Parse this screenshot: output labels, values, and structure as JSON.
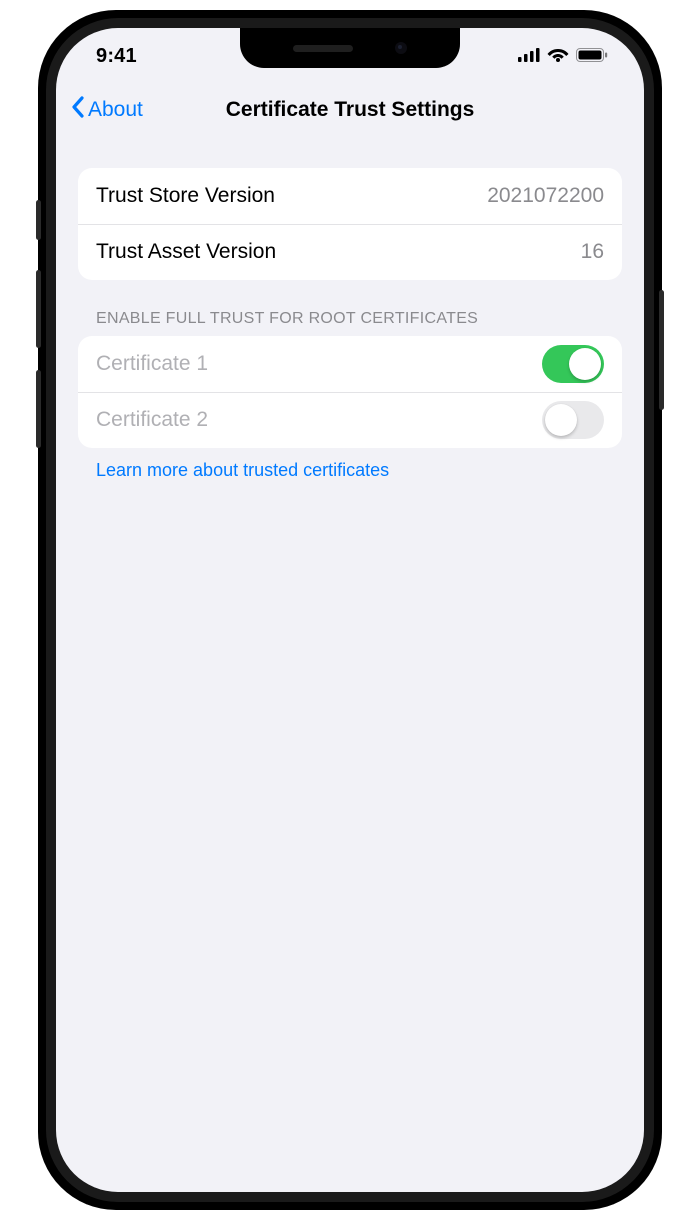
{
  "statusBar": {
    "time": "9:41"
  },
  "nav": {
    "back": "About",
    "title": "Certificate Trust Settings"
  },
  "versions": {
    "rows": [
      {
        "label": "Trust Store Version",
        "value": "2021072200"
      },
      {
        "label": "Trust Asset Version",
        "value": "16"
      }
    ]
  },
  "trustSection": {
    "header": "ENABLE FULL TRUST FOR ROOT CERTIFICATES",
    "rows": [
      {
        "label": "Certificate 1",
        "on": true
      },
      {
        "label": "Certificate 2",
        "on": false
      }
    ],
    "footerLink": "Learn more about trusted certificates"
  }
}
